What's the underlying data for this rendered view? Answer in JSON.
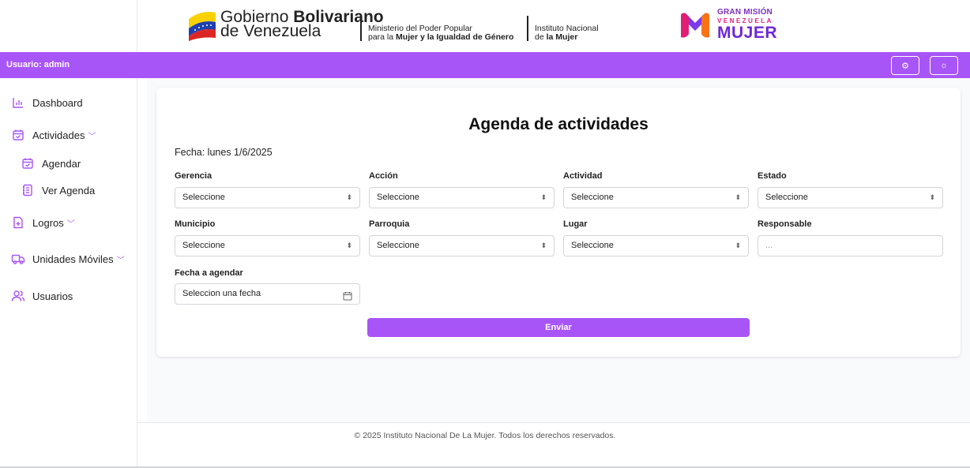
{
  "header": {
    "gob_line1_a": "Gobierno ",
    "gob_line1_b": "Bolivariano",
    "gob_line2": "de Venezuela",
    "ministerio_l1": "Ministerio del Poder Popular",
    "ministerio_l2a": "para la ",
    "ministerio_l2b": "Mujer y la Igualdad de Género",
    "instituto_l1": "Instituto Nacional",
    "instituto_l2a": "de ",
    "instituto_l2b": "la Mujer",
    "gm_l1": "GRAN MISIÓN",
    "gm_l2": "VENEZUELA",
    "gm_l3": "MUJER"
  },
  "topbar": {
    "user_label": "Usuario: admin",
    "settings_icon": "⚙",
    "theme_icon": "☼"
  },
  "sidebar": {
    "items": [
      {
        "label": "Dashboard",
        "icon": "chart-icon"
      },
      {
        "label": "Actividades",
        "icon": "calendar-icon"
      },
      {
        "label": "Agendar",
        "icon": "calendar-check-icon"
      },
      {
        "label": "Ver Agenda",
        "icon": "notebook-icon"
      },
      {
        "label": "Logros",
        "icon": "file-plus-icon"
      },
      {
        "label": "Unidades Móviles",
        "icon": "truck-icon"
      },
      {
        "label": "Usuarios",
        "icon": "users-icon"
      }
    ],
    "chevron": "﹀"
  },
  "form": {
    "title": "Agenda de actividades",
    "fecha": "Fecha: lunes 1/6/2025",
    "fields": {
      "gerencia": {
        "label": "Gerencia",
        "value": "Seleccione"
      },
      "accion": {
        "label": "Acción",
        "value": "Seleccione"
      },
      "actividad": {
        "label": "Actividad",
        "value": "Seleccione"
      },
      "estado": {
        "label": "Estado",
        "value": "Seleccione"
      },
      "municipio": {
        "label": "Municipio",
        "value": "Seleccione"
      },
      "parroquia": {
        "label": "Parroquia",
        "value": "Seleccione"
      },
      "lugar": {
        "label": "Lugar",
        "value": "Seleccione"
      },
      "responsable": {
        "label": "Responsable",
        "placeholder": "..."
      },
      "fecha_agendar": {
        "label": "Fecha a agendar",
        "placeholder": "Seleccion una fecha"
      }
    },
    "submit": "Enviar",
    "select_arrow": "⬍"
  },
  "footer": {
    "text": "© 2025 Instituto Nacional De La Mujer. Todos los derechos reservados."
  },
  "colors": {
    "accent": "#a855f7",
    "background": "#f9fafb"
  }
}
